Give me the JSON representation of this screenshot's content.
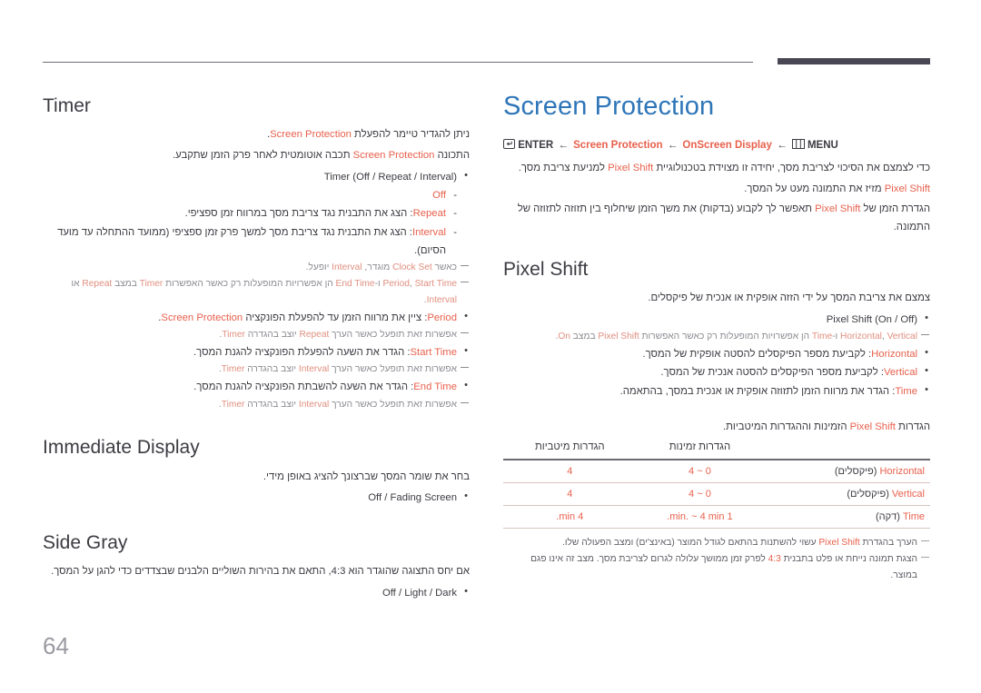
{
  "page": {
    "number": "64",
    "chapter_title": "Screen Protection"
  },
  "menu_path": {
    "menu_icon": "menu-grid-icon",
    "menu_label": "MENU",
    "arrow": "←",
    "step1": "OnScreen Display",
    "step2": "Screen Protection",
    "enter_icon": "enter-key-icon",
    "enter_label": "ENTER"
  },
  "intro": {
    "line1_pre": "כדי לצמצם את הסיכוי לצריבת מסך, יחידה זו מצוידת בטכנולוגיית ",
    "line1_hl": "Pixel Shift",
    "line1_post": " למניעת צריבת מסך.",
    "line2_hl": "Pixel Shift",
    "line2_post": " מזיז את התמונה מעט על המסך.",
    "line3_pre": "הגדרת הזמן של ",
    "line3_hl": "Pixel Shift",
    "line3_post": " תאפשר לך לקבוע (בדקות) את משך הזמן שיחלוף בין תזוזה לתזוזה של התמונה."
  },
  "pixel_shift": {
    "title": "Pixel Shift",
    "desc": "צמצם את צריבת המסך על ידי הזזה אופקית או אנכית של פיקסלים.",
    "bullets": [
      {
        "text": "Pixel Shift (On / Off)",
        "accent": true
      },
      {
        "text": "Horizontal: לקביעת מספר הפיקסלים להסטה אופקית של המסך.",
        "accent": false,
        "hl": "Horizontal"
      },
      {
        "text": "Vertical: לקביעת מספר הפיקסלים להסטה אנכית של המסך.",
        "accent": false,
        "hl": "Vertical"
      },
      {
        "text": "Time: הגדר את מרווח הזמן לתזוזה אופקית או אנכית במסך, בהתאמה.",
        "accent": false,
        "hl": "Time"
      }
    ],
    "note_after_first": "Horizontal, Vertical ו-Time הן אפשרויות המופעלות רק כאשר האפשרות Pixel Shift במצב On.",
    "note_after_first_parts": {
      "hl1": "Horizontal",
      "sep1": ", ",
      "hl2": "Vertical",
      "mid": " ו-",
      "hl3": "Time",
      "text": " הן אפשרויות המופעלות רק כאשר האפשרות ",
      "hl4": "Pixel Shift",
      "text2": " במצב ",
      "hl5": "On",
      "end": "."
    }
  },
  "table": {
    "caption_pre": "הגדרות ",
    "caption_hl": "Pixel Shift",
    "caption_post": " הזמינות וההגדרות המיטביות.",
    "headers": [
      "",
      "הגדרות זמינות",
      "הגדרות מיטביות"
    ],
    "rows": [
      {
        "label_hl": "Horizontal",
        "label_unit": " (פיקסלים)",
        "available": "0 ~ 4",
        "optimal": "4"
      },
      {
        "label_hl": "Vertical",
        "label_unit": " (פיקסלים)",
        "available": "0 ~ 4",
        "optimal": "4"
      },
      {
        "label_hl": "Time",
        "label_unit": " (דקה)",
        "available": "1 min. ~ 4 min.",
        "optimal": "4 min."
      }
    ],
    "notes": [
      {
        "pre": "הערך בהגדרת ",
        "hl": "Pixel Shift",
        "post": " עשוי להשתנות בהתאם לגודל המוצר (באינצ'ים) ומצב הפעולה שלו."
      },
      {
        "pre": "הצגת תמונה נייחת או פלט בתבנית ",
        "hl": "4:3",
        "post": " לפרק זמן ממושך עלולה לגרום לצריבת מסך. מצב זה אינו פגם במוצר."
      }
    ]
  },
  "timer": {
    "title": "Timer",
    "desc1_pre": "ניתן להגדיר טיימר להפעלת ",
    "desc1_hl": "Screen Protection",
    "desc1_post": ".",
    "desc2_pre": "התכונה ",
    "desc2_hl": "Screen Protection",
    "desc2_post": " תכבה אוטומטית לאחר פרק הזמן שתקבע.",
    "bullet_timer": "Timer (Off / Repeat / Interval)",
    "sub_items": [
      {
        "hl": "Off",
        "text": ""
      },
      {
        "hl": "Repeat",
        "text": ": הצג את התבנית נגד צריבת מסך במרווח זמן ספציפי."
      },
      {
        "hl": "Interval",
        "text": ": הצג את התבנית נגד צריבת מסך למשך פרק זמן ספציפי (ממועד ההתחלה עד מועד הסיום)."
      }
    ],
    "note_clock": {
      "pre": "כאשר ",
      "hl1": "Clock Set",
      "mid": " מוגדר, ",
      "hl2": "Interval",
      "post": " יופעל."
    },
    "note_period": {
      "hl1": "Period",
      "s1": ", ",
      "hl2": "Start Time",
      "s2": " ו-",
      "hl3": "End Time",
      "t1": " הן אפשרויות המופעלות רק כאשר האפשרות ",
      "hl4": "Timer",
      "t2": " במצב ",
      "hl5": "Repeat",
      "t3": " או ",
      "hl6": "Interval",
      "t4": "."
    },
    "bullets2": [
      {
        "hl": "Period",
        "text": ": ציין את מרווח הזמן עד להפעלת הפונקציה ",
        "hl2": "Screen Protection",
        "tail": "."
      },
      {
        "hl": "Start Time",
        "text": ": הגדר את השעה להפעלת הפונקציה להגנת המסך.",
        "hl2": "",
        "tail": ""
      },
      {
        "hl": "End Time",
        "text": ": הגדר את השעה להשבתת הפונקציה להגנת המסך.",
        "hl2": "",
        "tail": ""
      }
    ],
    "notes2": [
      {
        "pre": "אפשרות זאת תופעל כאשר הערך ",
        "hl": "Repeat",
        "mid": " יוצב בהגדרה ",
        "hl2": "Timer",
        "post": "."
      },
      {
        "pre": "אפשרות זאת תופעל כאשר הערך ",
        "hl": "Interval",
        "mid": " יוצב בהגדרה ",
        "hl2": "Timer",
        "post": "."
      },
      {
        "pre": "אפשרות זאת תופעל כאשר הערך ",
        "hl": "Interval",
        "mid": " יוצב בהגדרה ",
        "hl2": "Timer",
        "post": "."
      }
    ]
  },
  "immediate_display": {
    "title": "Immediate Display",
    "desc": "בחר את שומר המסך שברצונך להציג באופן מידי.",
    "bullet": "Off / Fading Screen"
  },
  "side_gray": {
    "title": "Side Gray",
    "desc_pre": "אם יחס התצוגה שהוגדר הוא ",
    "desc_hl": "4:3",
    "desc_post": ", התאם את בהירות השוליים הלבנים שבצדדים כדי להגן על המסך.",
    "bullet": "Off / Light / Dark"
  },
  "colors": {
    "accent": "#e8604c",
    "chapter_blue": "#2f76b8",
    "body_text": "#3c3b42",
    "note_gray": "#8b8b92",
    "page_number": "#9a9aa2",
    "rule_dark": "#4a4754",
    "table_rule": "#d8c4bd"
  }
}
